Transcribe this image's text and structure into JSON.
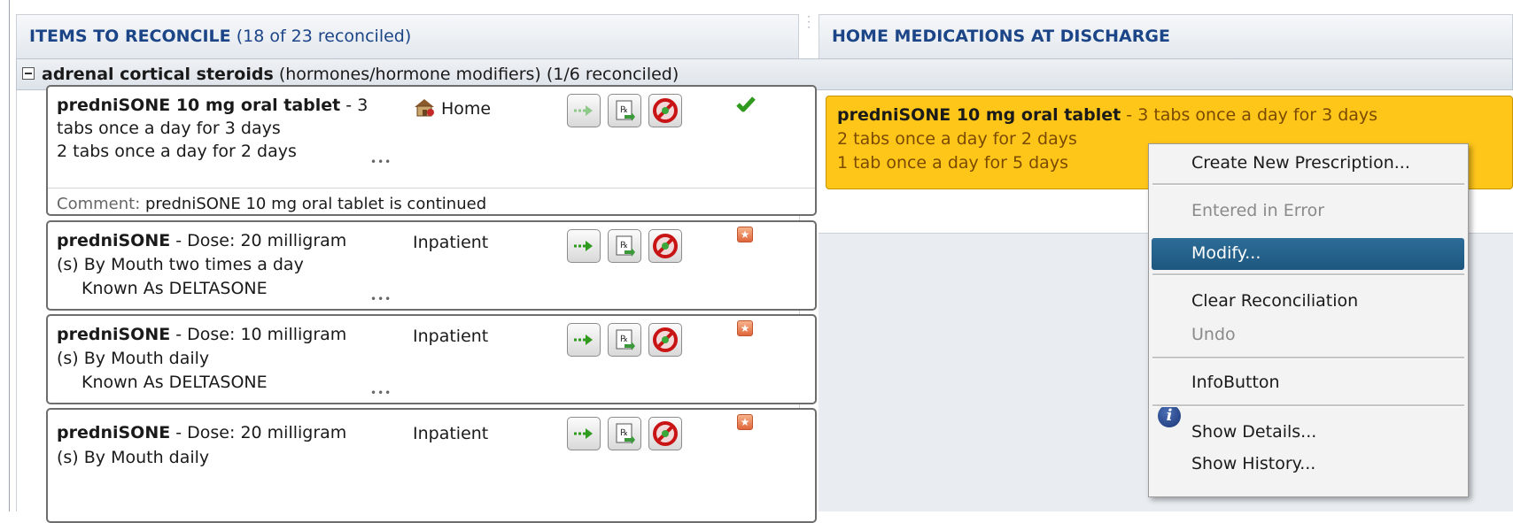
{
  "left_header": {
    "title": "ITEMS TO RECONCILE",
    "count": "(18 of 23 reconciled)"
  },
  "right_header": {
    "title": "HOME MEDICATIONS AT DISCHARGE"
  },
  "group": {
    "name": "adrenal cortical steroids",
    "detail": "(hormones/hormone modifiers) (1/6 reconciled)"
  },
  "cards": [
    {
      "name": "predniSONE 10 mg oral tablet",
      "line1_rest": " - 3",
      "line2": "tabs once a day for 3 days",
      "line3": "2 tabs once a day for 2 days",
      "location": "Home",
      "comment_label": "Comment:",
      "comment": " predniSONE 10 mg oral tablet is continued"
    },
    {
      "name": "predniSONE",
      "line1_rest": " -   Dose: 20 milligram",
      "line2": "(s) By Mouth two times a day",
      "line3": "Known As DELTASONE",
      "location": "Inpatient"
    },
    {
      "name": "predniSONE",
      "line1_rest": " -   Dose: 10 milligram",
      "line2": "(s) By Mouth daily",
      "line3": "Known As DELTASONE",
      "location": "Inpatient"
    },
    {
      "name": "predniSONE",
      "line1_rest": " -   Dose: 20 milligram",
      "line2": "(s) By Mouth daily",
      "location": "Inpatient"
    }
  ],
  "discharge_med": {
    "name": "predniSONE 10 mg oral tablet",
    "line1_rest": " - 3 tabs once a day for 3 days",
    "line2": "2 tabs once a day for 2 days",
    "line3": "1 tab once a day for 5 days"
  },
  "context_menu": {
    "items": [
      {
        "label": "Create New Prescription...",
        "state": "enabled"
      },
      {
        "label": "Entered in Error",
        "state": "disabled"
      },
      {
        "label": "Modify...",
        "state": "highlighted"
      },
      {
        "label": "Clear Reconciliation",
        "state": "enabled"
      },
      {
        "label": "Undo",
        "state": "disabled"
      },
      {
        "label": "InfoButton",
        "state": "enabled"
      },
      {
        "label": "Show Details...",
        "state": "enabled"
      },
      {
        "label": "Show History...",
        "state": "enabled"
      }
    ]
  },
  "dots": "•••",
  "colors": {
    "header_text": "#1c4587",
    "selected_card": "#ffc61a",
    "menu_highlight": "#1d577f",
    "check": "#2f9a1e",
    "flag": "#e0663b"
  },
  "icons": [
    "continue-arrow-icon",
    "prescription-icon",
    "stop-icon",
    "home-icon",
    "checkmark-icon",
    "flag-icon",
    "info-icon"
  ]
}
